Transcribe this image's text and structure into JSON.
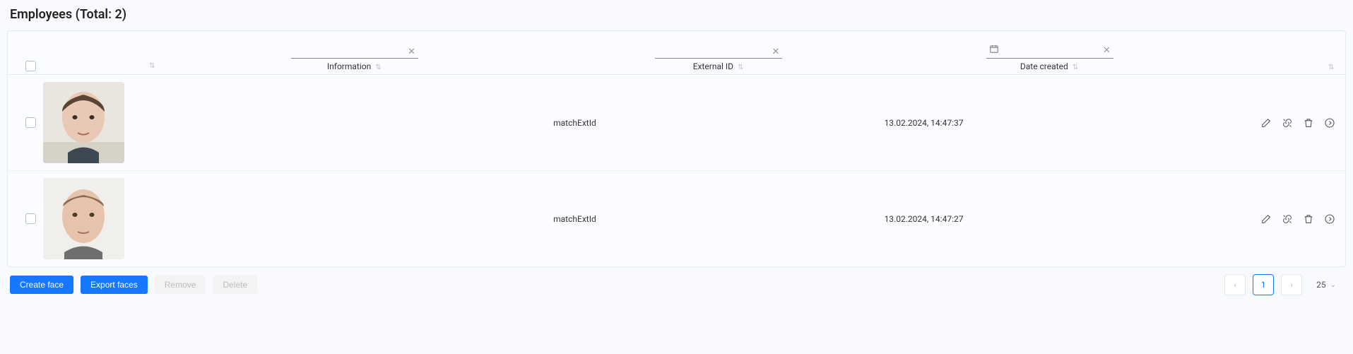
{
  "title_prefix": "Employees",
  "title_total_label": "Total",
  "total_count": 2,
  "columns": {
    "information_label": "Information",
    "external_id_label": "External ID",
    "date_created_label": "Date created"
  },
  "filters": {
    "information_value": "",
    "external_id_value": "",
    "date_value": ""
  },
  "rows": [
    {
      "information": "",
      "external_id": "matchExtId",
      "date_created": "13.02.2024, 14:47:37"
    },
    {
      "information": "",
      "external_id": "matchExtId",
      "date_created": "13.02.2024, 14:47:27"
    }
  ],
  "buttons": {
    "create_face": "Create face",
    "export_faces": "Export faces",
    "remove": "Remove",
    "delete": "Delete"
  },
  "pagination": {
    "current_page": 1,
    "page_size": 25
  }
}
